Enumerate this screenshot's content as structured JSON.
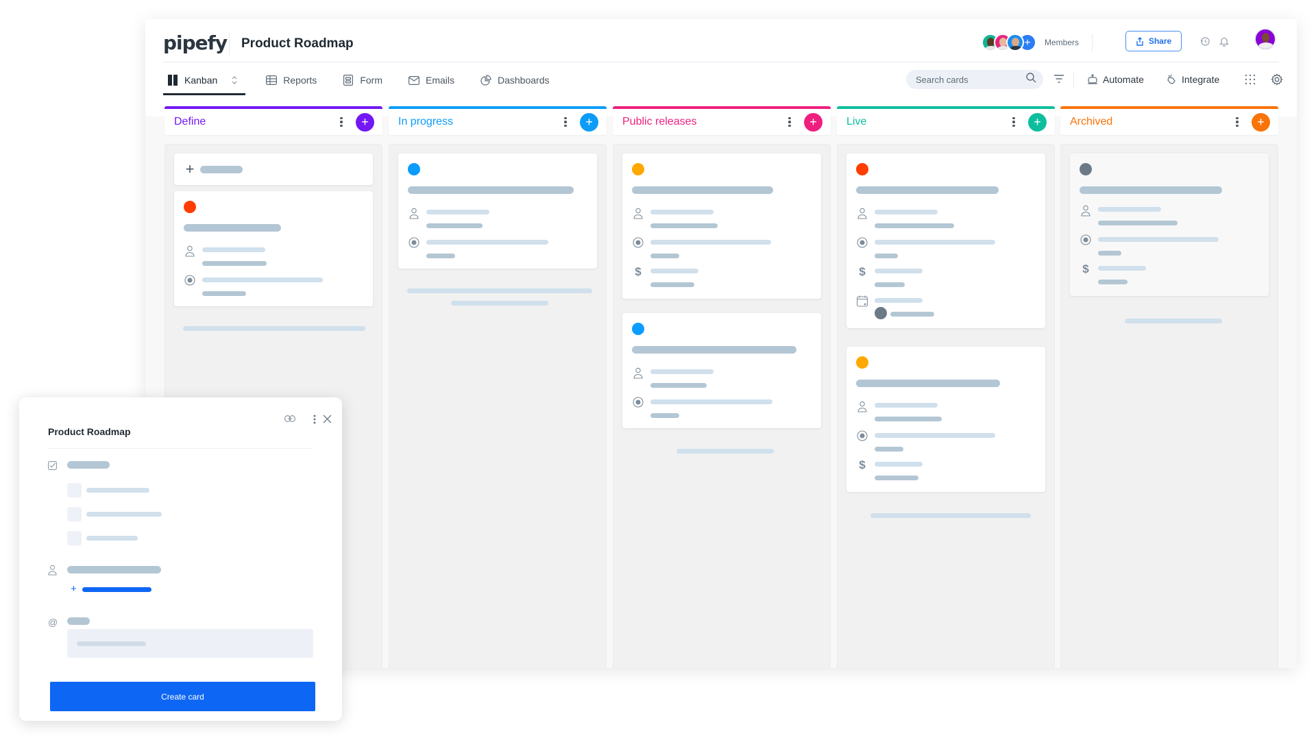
{
  "app": {
    "logo": "pipefy",
    "pipe_title": "Product Roadmap"
  },
  "header": {
    "members_label": "Members",
    "member_avatars": [
      {
        "name": "member-1",
        "ring": "#0fb595",
        "skin": "#5a3a24"
      },
      {
        "name": "member-2",
        "ring": "#e8247c",
        "skin": "#e6b89c"
      },
      {
        "name": "member-3",
        "ring": "#1a8cf0",
        "skin": "#d9a988"
      }
    ],
    "add_member_symbol": "+",
    "share_label": "Share"
  },
  "tabs": [
    {
      "label": "Kanban",
      "icon": "kanban-icon",
      "active": true
    },
    {
      "label": "Reports",
      "icon": "table-icon",
      "active": false
    },
    {
      "label": "Form",
      "icon": "form-icon",
      "active": false
    },
    {
      "label": "Emails",
      "icon": "mail-icon",
      "active": false
    },
    {
      "label": "Dashboards",
      "icon": "pie-chart-icon",
      "active": false
    }
  ],
  "toolbar": {
    "search_placeholder": "Search cards",
    "automate_label": "Automate",
    "integrate_label": "Integrate"
  },
  "columns": [
    {
      "title": "Define",
      "color": "#7317f5",
      "add_symbol": "+"
    },
    {
      "title": "In progress",
      "color": "#0c9cf7",
      "add_symbol": "+"
    },
    {
      "title": "Public releases",
      "color": "#ee1f7e",
      "add_symbol": "+"
    },
    {
      "title": "Live",
      "color": "#0dbe9e",
      "add_symbol": "+"
    },
    {
      "title": "Archived",
      "color": "#f97309",
      "add_symbol": "+"
    }
  ],
  "card_status_colors": {
    "red": "#ff3d00",
    "blue": "#0a9cff",
    "yellow": "#ffa800",
    "gray": "#6c7a87"
  },
  "modal": {
    "title": "Product Roadmap",
    "add_symbol": "+",
    "create_label": "Create card"
  }
}
